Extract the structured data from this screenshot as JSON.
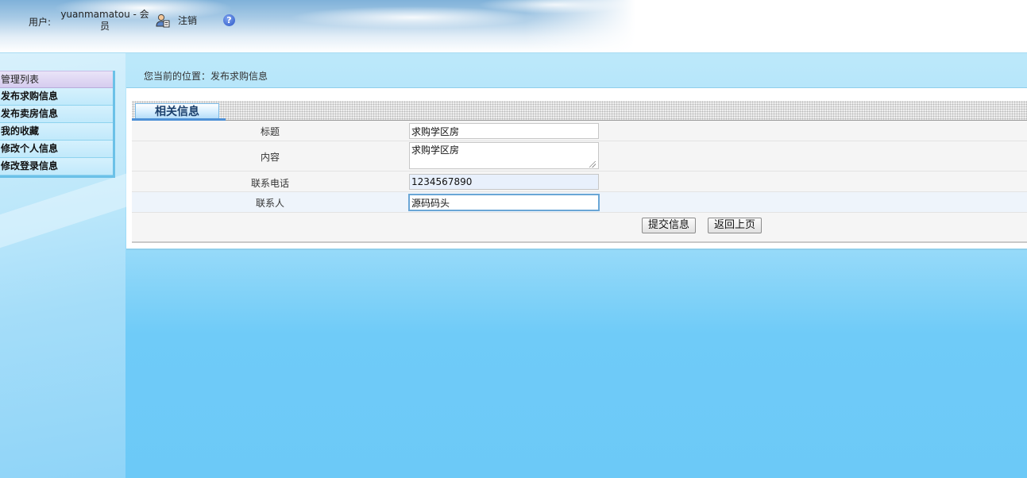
{
  "header": {
    "user_label": "用户:",
    "user_name": "yuanmamatou - 会员",
    "logout_label": "注销",
    "help_glyph": "?"
  },
  "sidebar": {
    "title": "管理列表",
    "items": [
      {
        "label": "发布求购信息"
      },
      {
        "label": "发布卖房信息"
      },
      {
        "label": "我的收藏"
      },
      {
        "label": "修改个人信息"
      },
      {
        "label": "修改登录信息"
      }
    ]
  },
  "breadcrumb": "您当前的位置：发布求购信息",
  "panel": {
    "tab_label": "相关信息",
    "fields": {
      "title": {
        "label": "标题",
        "value": "求购学区房"
      },
      "content": {
        "label": "内容",
        "value": "求购学区房"
      },
      "phone": {
        "label": "联系电话",
        "value": "1234567890"
      },
      "contact": {
        "label": "联系人",
        "value": "源码码头"
      }
    },
    "submit_label": "提交信息",
    "back_label": "返回上页"
  },
  "colors": {
    "menu_border": "#6bc1e8",
    "tab_text": "#1b3f6b",
    "page_bg": "#6cc9f7"
  },
  "icons": [
    "user-icon",
    "help-icon",
    "resize-grip-icon"
  ]
}
